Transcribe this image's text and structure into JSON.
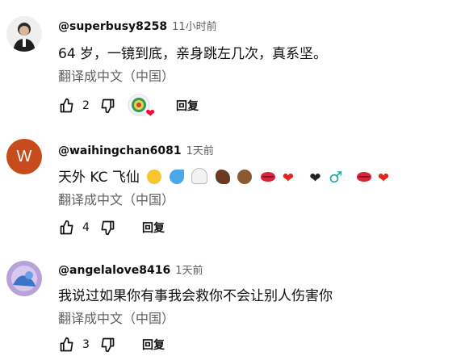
{
  "comments": [
    {
      "handle": "@superbusy8258",
      "time": "11小时前",
      "text": "64 岁，一镜到底，亲身跳左几次，真系坚。",
      "translate": "翻译成中文（中国）",
      "likes": "2",
      "reply": "回复",
      "hearted": true,
      "avatar_colors": [
        "#f3f3f3",
        "#2b2b2b"
      ]
    },
    {
      "handle": "@waihingchan6081",
      "time": "1天前",
      "text": "天外 KC 飞仙",
      "emojis": [
        "rolling-laughing",
        "sweat-drops",
        "ghost",
        "flexed-biceps",
        "bearded-person",
        "lips",
        "red-heart",
        "black-heart",
        "male-sign",
        "lips",
        "red-heart"
      ],
      "translate": "翻译成中文（中国）",
      "likes": "4",
      "reply": "回复",
      "avatar_letter": "W",
      "avatar_color": "#c74b1c"
    },
    {
      "handle": "@angelalove8416",
      "time": "1天前",
      "text": "我说过如果你有事我会救你不会让别人伤害你",
      "translate": "翻译成中文（中国）",
      "likes": "3",
      "reply": "回复",
      "avatar_colors": [
        "#b7a1d8",
        "#3c74c9"
      ]
    }
  ]
}
